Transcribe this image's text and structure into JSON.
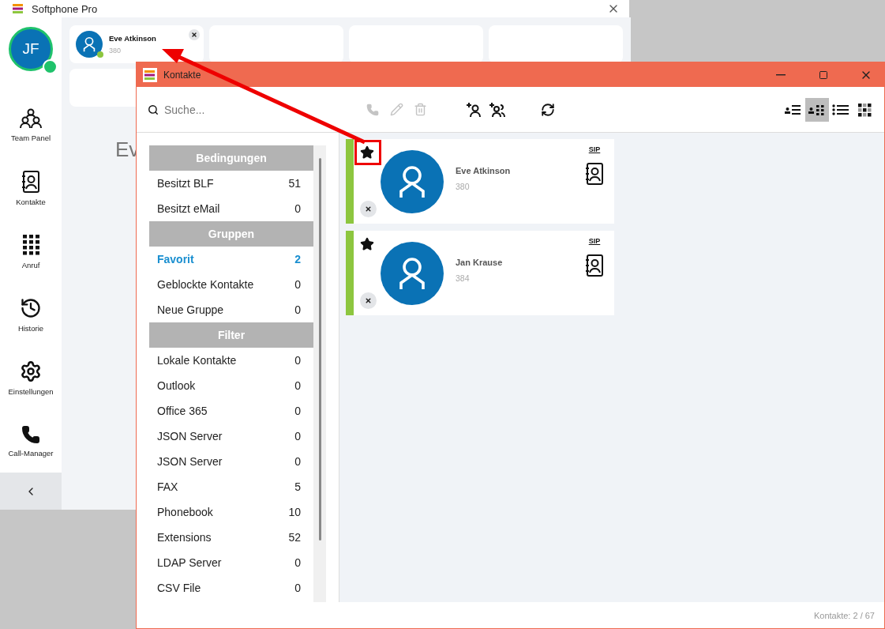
{
  "main_window": {
    "title": "Softphone Pro",
    "user": {
      "initials": "JF",
      "online": true
    },
    "nav": [
      {
        "kind": "team",
        "label": "Team Panel",
        "selected": false
      },
      {
        "kind": "contacts",
        "label": "Kontakte",
        "selected": false
      },
      {
        "kind": "dialpad",
        "label": "Anruf",
        "selected": false
      },
      {
        "kind": "history",
        "label": "Historie",
        "selected": false
      },
      {
        "kind": "settings",
        "label": "Einstellungen",
        "selected": false
      },
      {
        "kind": "callmanager",
        "label": "Call-Manager",
        "selected": false
      }
    ],
    "team_cards": [
      {
        "name": "Eve Atkinson",
        "number": "380",
        "online": true
      }
    ],
    "background_text": "Ev"
  },
  "contacts_window": {
    "title": "Kontakte",
    "search": {
      "placeholder": "Suche..."
    },
    "actions": [
      {
        "kind": "call",
        "disabled": true
      },
      {
        "kind": "edit",
        "disabled": true
      },
      {
        "kind": "delete",
        "disabled": true
      },
      {
        "kind": "add-contact",
        "disabled": false
      },
      {
        "kind": "add-group",
        "disabled": false
      },
      {
        "kind": "sync",
        "disabled": false
      }
    ],
    "view_modes": [
      {
        "kind": "card-list",
        "selected": false
      },
      {
        "kind": "card-grid",
        "selected": true
      },
      {
        "kind": "list",
        "selected": false
      },
      {
        "kind": "tiles",
        "selected": false
      }
    ],
    "sections": [
      {
        "title": "Bedingungen",
        "items": [
          {
            "label": "Besitzt BLF",
            "count": "51",
            "selected": false
          },
          {
            "label": "Besitzt eMail",
            "count": "0",
            "selected": false
          }
        ]
      },
      {
        "title": "Gruppen",
        "items": [
          {
            "label": "Favorit",
            "count": "2",
            "selected": true
          },
          {
            "label": "Geblockte Kontakte",
            "count": "0",
            "selected": false
          },
          {
            "label": "Neue Gruppe",
            "count": "0",
            "selected": false
          }
        ]
      },
      {
        "title": "Filter",
        "items": [
          {
            "label": "Lokale Kontakte",
            "count": "0",
            "selected": false
          },
          {
            "label": "Outlook",
            "count": "0",
            "selected": false
          },
          {
            "label": "Office 365",
            "count": "0",
            "selected": false
          },
          {
            "label": "JSON Server",
            "count": "0",
            "selected": false
          },
          {
            "label": "JSON Server",
            "count": "0",
            "selected": false
          },
          {
            "label": "FAX",
            "count": "5",
            "selected": false
          },
          {
            "label": "Phonebook",
            "count": "10",
            "selected": false
          },
          {
            "label": "Extensions",
            "count": "52",
            "selected": false
          },
          {
            "label": "LDAP Server",
            "count": "0",
            "selected": false
          },
          {
            "label": "CSV File",
            "count": "0",
            "selected": false
          }
        ]
      }
    ],
    "contacts": [
      {
        "name": "Eve Atkinson",
        "number": "380",
        "favorite": true,
        "protocol": "SIP",
        "highlighted": true
      },
      {
        "name": "Jan Krause",
        "number": "384",
        "favorite": true,
        "protocol": "SIP",
        "highlighted": false
      }
    ],
    "footer": "Kontakte: 2 / 67"
  }
}
